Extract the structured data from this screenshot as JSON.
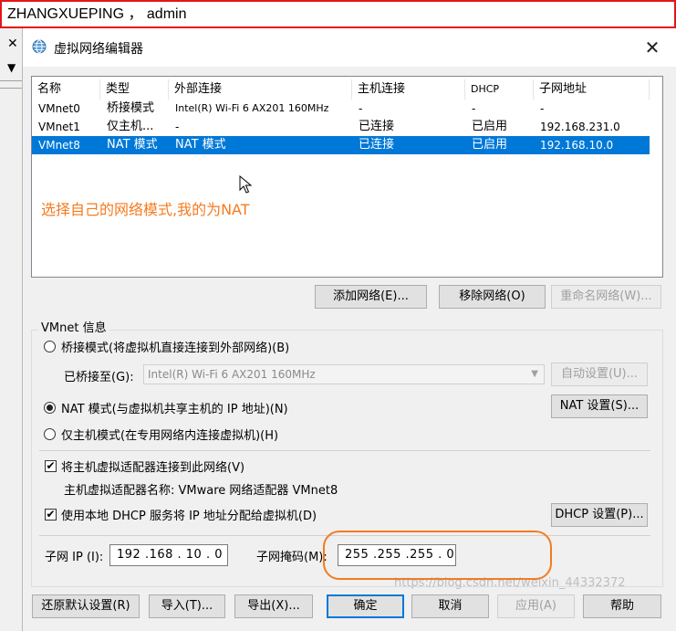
{
  "annotation_bar": {
    "text": "ZHANGXUEPING ， admin"
  },
  "background_window": {
    "close_glyph": "✕",
    "dropdown_glyph": "▼"
  },
  "dialog": {
    "title": "虚拟网络编辑器",
    "close_glyph": "✕"
  },
  "list": {
    "headers": [
      "名称",
      "类型",
      "外部连接",
      "主机连接",
      "DHCP",
      "子网地址"
    ],
    "rows": [
      [
        "VMnet0",
        "桥接模式",
        "Intel(R) Wi-Fi 6 AX201 160MHz",
        "-",
        "-",
        "-"
      ],
      [
        "VMnet1",
        "仅主机...",
        "-",
        "已连接",
        "已启用",
        "192.168.231.0"
      ],
      [
        "VMnet8",
        "NAT 模式",
        "NAT 模式",
        "已连接",
        "已启用",
        "192.168.10.0"
      ]
    ],
    "annotation": "选择自己的网络模式,我的为NAT"
  },
  "list_buttons": {
    "add": "添加网络(E)...",
    "remove": "移除网络(O)",
    "rename": "重命名网络(W)..."
  },
  "vmnet_info": {
    "legend": "VMnet 信息",
    "bridged_label": "桥接模式(将虚拟机直接连接到外部网络)(B)",
    "bridged_to_label": "已桥接至(G):",
    "bridged_to_value": "Intel(R) Wi-Fi 6 AX201 160MHz",
    "auto_settings": "自动设置(U)...",
    "nat_label": "NAT 模式(与虚拟机共享主机的 IP 地址)(N)",
    "nat_settings": "NAT 设置(S)...",
    "hostonly_label": "仅主机模式(在专用网络内连接虚拟机)(H)",
    "connect_adapter_label": "将主机虚拟适配器连接到此网络(V)",
    "adapter_name_label": "主机虚拟适配器名称: VMware 网络适配器 VMnet8",
    "dhcp_label": "使用本地 DHCP 服务将 IP 地址分配给虚拟机(D)",
    "dhcp_settings": "DHCP 设置(P)...",
    "subnet_ip_label": "子网 IP (I):",
    "subnet_ip_value": "192 .168 . 10  .  0",
    "subnet_mask_label": "子网掩码(M):",
    "subnet_mask_value": "255 .255 .255 .  0",
    "check_glyph": "✔"
  },
  "bottom_buttons": {
    "restore": "还原默认设置(R)",
    "import": "导入(T)...",
    "export": "导出(X)...",
    "ok": "确定",
    "cancel": "取消",
    "apply": "应用(A)",
    "help": "帮助"
  },
  "watermark": "https://blog.csdn.net/weixin_44332372",
  "colors": {
    "selection": "#0078d7",
    "annotation": "#f47b20",
    "border_red": "#e3151a"
  }
}
